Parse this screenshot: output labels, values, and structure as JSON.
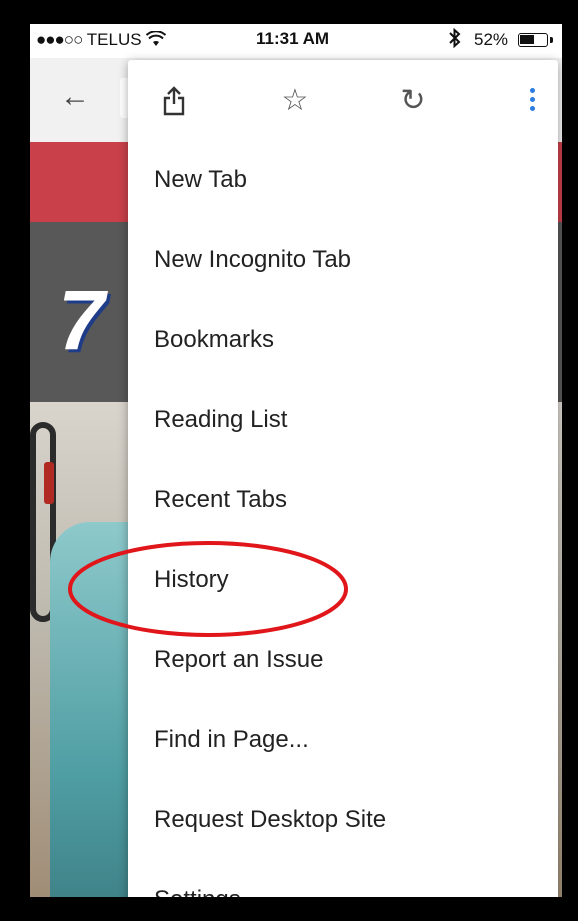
{
  "status_bar": {
    "carrier_dots": "●●●○○",
    "carrier": "TELUS",
    "wifi_icon": "wifi-icon",
    "time": "11:31 AM",
    "bluetooth_icon": "bluetooth-icon",
    "battery_percent": "52%",
    "battery_level": 0.52
  },
  "toolbar": {
    "back_icon": "back-arrow-icon",
    "back_glyph": "←"
  },
  "page": {
    "logo_text": "7",
    "brand_red": "#c9404a",
    "logo_blue": "#1f3c88"
  },
  "menu": {
    "icons": [
      "share-icon",
      "star-icon",
      "reload-icon",
      "more-vertical-icon"
    ],
    "star_glyph": "☆",
    "reload_glyph": "↻",
    "more_color": "#2a7de1",
    "items": [
      "New Tab",
      "New Incognito Tab",
      "Bookmarks",
      "Reading List",
      "Recent Tabs",
      "History",
      "Report an Issue",
      "Find in Page...",
      "Request Desktop Site",
      "Settings"
    ]
  },
  "annotation": {
    "target": "History",
    "color": "#e0161a",
    "shape": "ellipse"
  }
}
